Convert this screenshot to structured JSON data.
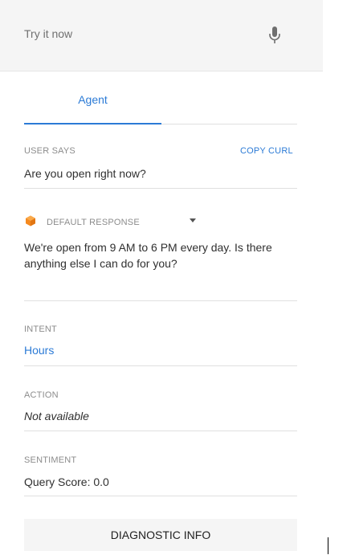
{
  "try_it": {
    "placeholder": "Try it now"
  },
  "tabs": [
    {
      "label": "Agent"
    }
  ],
  "user_says": {
    "label": "USER SAYS",
    "copy_link": "COPY CURL",
    "value": "Are you open right now?"
  },
  "response": {
    "label": "DEFAULT RESPONSE",
    "text": "We're open from 9 AM to 6 PM every day. Is there anything else I can do for you?",
    "icon": "cube-icon",
    "accent": "#f5891f"
  },
  "intent": {
    "label": "INTENT",
    "value": "Hours"
  },
  "action": {
    "label": "ACTION",
    "value": "Not available"
  },
  "sentiment": {
    "label": "SENTIMENT",
    "value": "Query Score: 0.0"
  },
  "diagnostic_button": "DIAGNOSTIC INFO",
  "colors": {
    "accent": "#2c7bd6",
    "header_bg": "#f5f5f5",
    "divider": "#e0e0e0"
  }
}
